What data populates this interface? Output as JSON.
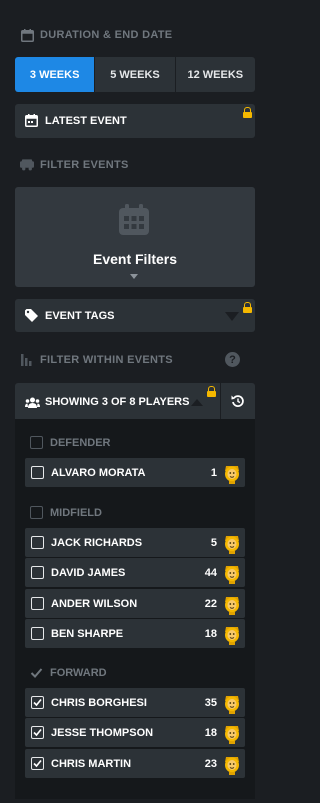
{
  "duration": {
    "header": "DURATION & END DATE",
    "options": [
      {
        "label": "3 WEEKS",
        "active": true
      },
      {
        "label": "5 WEEKS",
        "active": false
      },
      {
        "label": "12 WEEKS",
        "active": false
      }
    ],
    "latest_event_label": "LATEST EVENT"
  },
  "filter_events": {
    "header": "FILTER EVENTS",
    "event_filters_label": "Event Filters",
    "event_tags_label": "EVENT TAGS"
  },
  "filter_within": {
    "header": "FILTER WITHIN EVENTS",
    "showing_label": "SHOWING 3 OF 8 PLAYERS"
  },
  "groups": [
    {
      "name": "DEFENDER",
      "checked": false,
      "players": [
        {
          "name": "ALVARO MORATA",
          "number": "1",
          "checked": false
        }
      ]
    },
    {
      "name": "MIDFIELD",
      "checked": false,
      "players": [
        {
          "name": "JACK RICHARDS",
          "number": "5",
          "checked": false
        },
        {
          "name": "DAVID JAMES",
          "number": "44",
          "checked": false
        },
        {
          "name": "ANDER WILSON",
          "number": "22",
          "checked": false
        },
        {
          "name": "BEN SHARPE",
          "number": "18",
          "checked": false
        }
      ]
    },
    {
      "name": "FORWARD",
      "checked": true,
      "players": [
        {
          "name": "CHRIS BORGHESI",
          "number": "35",
          "checked": true
        },
        {
          "name": "JESSE THOMPSON",
          "number": "18",
          "checked": true
        },
        {
          "name": "CHRIS MARTIN",
          "number": "23",
          "checked": true
        }
      ]
    }
  ],
  "colors": {
    "accent": "#1e88e5",
    "lock": "#f5b800",
    "panel": "#2c3237",
    "background": "#1b1e22"
  }
}
